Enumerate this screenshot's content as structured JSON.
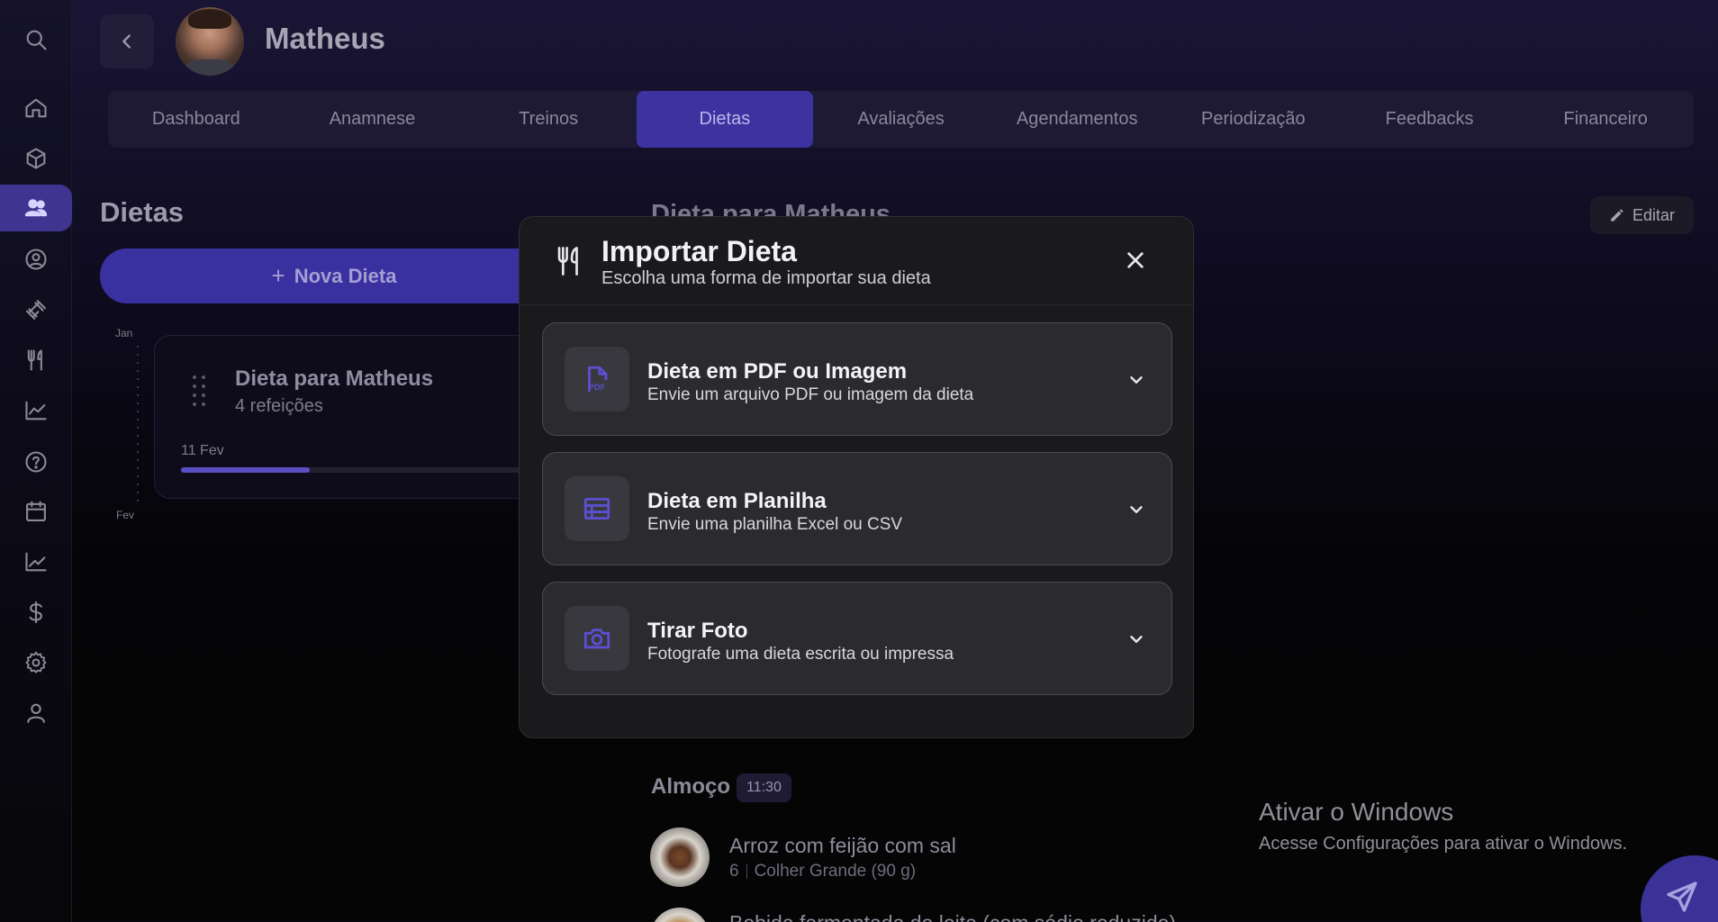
{
  "header": {
    "profile_name": "Matheus"
  },
  "tabs": [
    {
      "label": "Dashboard"
    },
    {
      "label": "Anamnese"
    },
    {
      "label": "Treinos"
    },
    {
      "label": "Dietas",
      "active": true
    },
    {
      "label": "Avaliações"
    },
    {
      "label": "Agendamentos"
    },
    {
      "label": "Periodização"
    },
    {
      "label": "Feedbacks"
    },
    {
      "label": "Financeiro"
    }
  ],
  "sidebar": {
    "icons": [
      "search-icon",
      "home-icon",
      "box-icon",
      "users-icon",
      "user-circle-icon",
      "dumbbell-icon",
      "utensils-icon",
      "chart-line-icon",
      "help-icon",
      "calendar-icon",
      "trending-icon",
      "dollar-icon",
      "gear-icon",
      "user-icon"
    ],
    "active": "users-icon"
  },
  "diets": {
    "title": "Dietas",
    "new_button": "Nova Dieta",
    "timeline_start": "Jan",
    "timeline_end": "Fev",
    "card": {
      "title": "Dieta para Matheus",
      "subtitle": "4 refeições",
      "date": "11 Fev",
      "progress": 0.34
    }
  },
  "detail": {
    "title": "Dieta para Matheus",
    "edit_label": "Editar",
    "meal": {
      "name": "Almoço",
      "time": "11:30",
      "foods": [
        {
          "name": "Arroz com feijão com sal",
          "amount": "6",
          "unit": "Colher Grande (90 g)"
        },
        {
          "name": "Bebida fermentada de leite (com sódio reduzido)"
        }
      ]
    }
  },
  "modal": {
    "title": "Importar Dieta",
    "subtitle": "Escolha uma forma de importar sua dieta",
    "options": [
      {
        "title": "Dieta em PDF ou Imagem",
        "subtitle": "Envie um arquivo PDF ou imagem da dieta",
        "icon": "pdf-file-icon",
        "icon_text": "PDF"
      },
      {
        "title": "Dieta em Planilha",
        "subtitle": "Envie uma planilha Excel ou CSV",
        "icon": "spreadsheet-icon"
      },
      {
        "title": "Tirar Foto",
        "subtitle": "Fotografe uma dieta escrita ou impressa",
        "icon": "camera-icon"
      }
    ]
  },
  "windows_watermark": {
    "title": "Ativar o Windows",
    "subtitle": "Acesse Configurações para ativar o Windows."
  },
  "colors": {
    "accent": "#3d33a0",
    "modal_bg": "#1a1a1c",
    "option_bg": "#2b2b2e",
    "icon_accent": "#5b4fd0"
  }
}
